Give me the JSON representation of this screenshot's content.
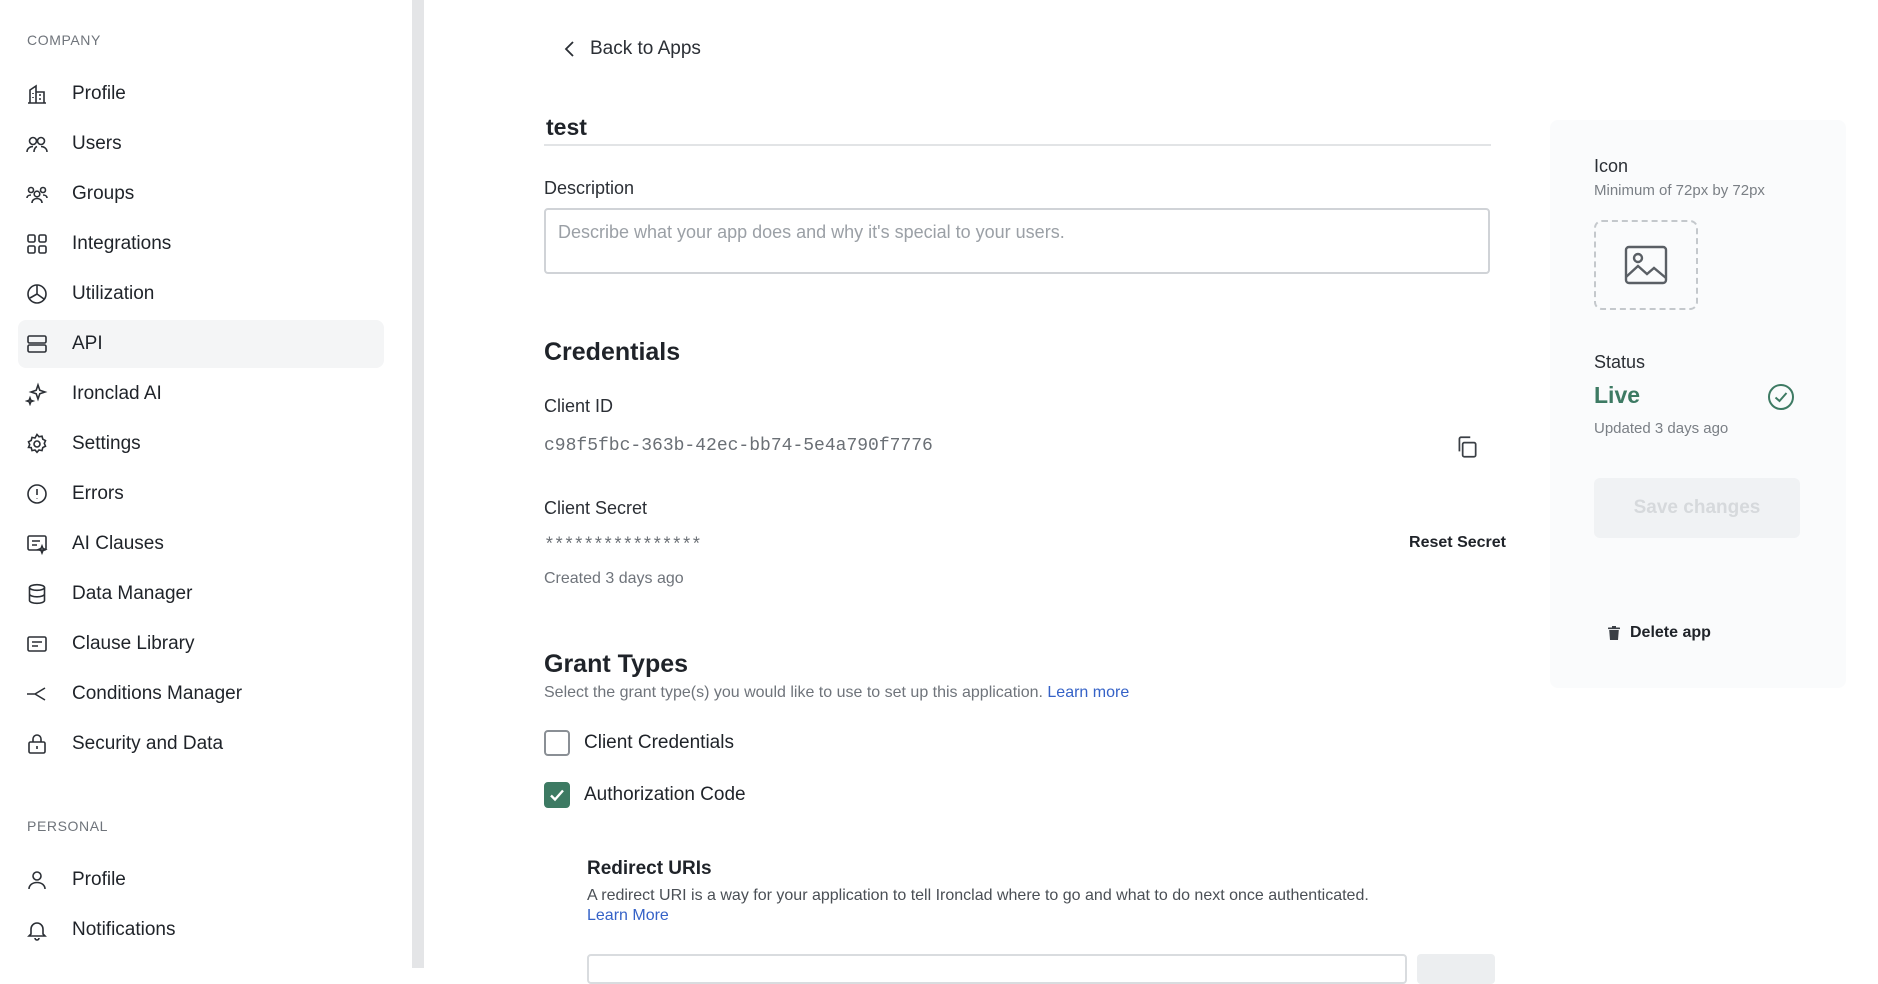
{
  "sidebar": {
    "company_label": "COMPANY",
    "company_items": [
      {
        "label": "Profile",
        "icon": "building-icon"
      },
      {
        "label": "Users",
        "icon": "users-icon"
      },
      {
        "label": "Groups",
        "icon": "groups-icon"
      },
      {
        "label": "Integrations",
        "icon": "grid-icon"
      },
      {
        "label": "Utilization",
        "icon": "chart-circle-icon"
      },
      {
        "label": "API",
        "icon": "server-icon",
        "active": true
      },
      {
        "label": "Ironclad AI",
        "icon": "sparkle-icon"
      },
      {
        "label": "Settings",
        "icon": "gear-icon"
      },
      {
        "label": "Errors",
        "icon": "alert-circle-icon"
      },
      {
        "label": "AI Clauses",
        "icon": "ai-clause-icon"
      },
      {
        "label": "Data Manager",
        "icon": "database-icon"
      },
      {
        "label": "Clause Library",
        "icon": "clause-card-icon"
      },
      {
        "label": "Conditions Manager",
        "icon": "branch-icon"
      },
      {
        "label": "Security and Data",
        "icon": "lock-icon"
      }
    ],
    "personal_label": "PERSONAL",
    "personal_items": [
      {
        "label": "Profile",
        "icon": "user-icon"
      },
      {
        "label": "Notifications",
        "icon": "bell-icon"
      }
    ]
  },
  "main": {
    "back_label": "Back to Apps",
    "app_name": "test",
    "description_label": "Description",
    "description_placeholder": "Describe what your app does and why it's special to your users.",
    "credentials_heading": "Credentials",
    "client_id_label": "Client ID",
    "client_id_value": "c98f5fbc-363b-42ec-bb74-5e4a790f7776",
    "client_secret_label": "Client Secret",
    "client_secret_value": "****************",
    "reset_secret_label": "Reset Secret",
    "secret_created": "Created 3 days ago",
    "grant_types_heading": "Grant Types",
    "grant_types_desc": "Select the grant type(s) you would like to use to set up this application.",
    "grant_types_learn_more": "Learn more",
    "grant_options": [
      {
        "label": "Client Credentials",
        "checked": false
      },
      {
        "label": "Authorization Code",
        "checked": true
      }
    ],
    "redirect_heading": "Redirect URIs",
    "redirect_desc": "A redirect URI is a way for your application to tell Ironclad where to go and what to do next once authenticated.",
    "redirect_learn_more": "Learn More"
  },
  "panel": {
    "icon_label": "Icon",
    "icon_hint": "Minimum of 72px by 72px",
    "status_label": "Status",
    "status_value": "Live",
    "status_updated": "Updated 3 days ago",
    "save_label": "Save changes",
    "delete_label": "Delete app"
  },
  "colors": {
    "accent_green": "#3d7a63",
    "link_blue": "#3562c7",
    "active_nav_bg": "#f4f5f6"
  }
}
